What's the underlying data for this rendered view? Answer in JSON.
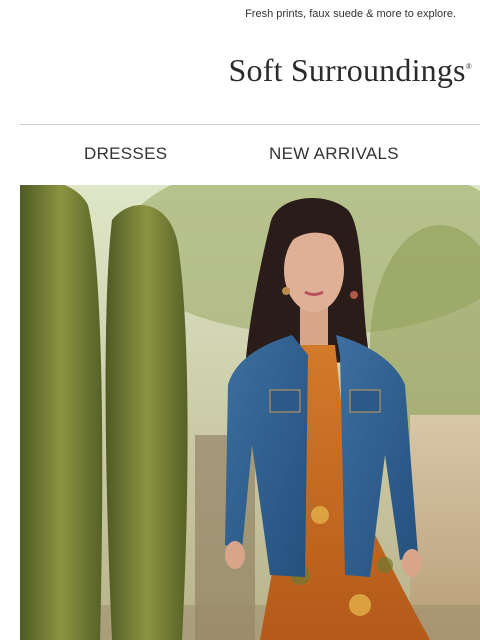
{
  "preheader": {
    "text": "Fresh prints, faux suede & more to explore."
  },
  "brand": {
    "name": "Soft Surroundings",
    "reg_mark": "®"
  },
  "nav": {
    "items": [
      {
        "label": "DRESSES"
      },
      {
        "label": "NEW ARRIVALS"
      }
    ]
  },
  "colors": {
    "text": "#333333",
    "divider": "#cfcfcf",
    "denim": "#2f5f8f",
    "dress_orange": "#c8691f",
    "foliage": "#6f8a3a"
  }
}
